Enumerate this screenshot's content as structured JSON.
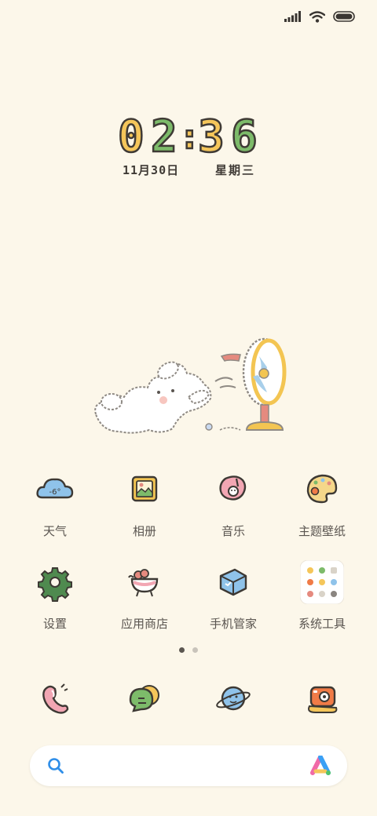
{
  "status_bar": {
    "signal_icon": "cellular-signal-icon",
    "wifi_icon": "wifi-icon",
    "battery_icon": "battery-icon"
  },
  "clock": {
    "d1": "0",
    "d2": "2",
    "colon": ":",
    "d3": "3",
    "d4": "6",
    "date": "11月30日",
    "weekday": "星期三",
    "colors": {
      "d1": "#f5c65a",
      "d2": "#7dbb6a",
      "d3": "#f5c65a",
      "d4": "#7dbb6a",
      "colon": "#f5c65a"
    }
  },
  "apps": [
    {
      "label": "天气",
      "icon": "weather-icon",
      "temp": "-6°"
    },
    {
      "label": "相册",
      "icon": "gallery-icon"
    },
    {
      "label": "音乐",
      "icon": "music-icon"
    },
    {
      "label": "主题壁纸",
      "icon": "themes-icon"
    },
    {
      "label": "设置",
      "icon": "settings-gear-icon"
    },
    {
      "label": "应用商店",
      "icon": "app-store-icon"
    },
    {
      "label": "手机管家",
      "icon": "security-cube-icon"
    },
    {
      "label": "系统工具",
      "icon": "system-tools-folder-icon"
    }
  ],
  "page_indicator": {
    "count": 2,
    "active": 0
  },
  "dock": [
    {
      "icon": "phone-icon"
    },
    {
      "icon": "messages-icon"
    },
    {
      "icon": "browser-planet-icon"
    },
    {
      "icon": "camera-icon"
    }
  ],
  "search_bar": {
    "search_icon": "search-icon",
    "assistant_icon": "assistant-logo-icon"
  }
}
